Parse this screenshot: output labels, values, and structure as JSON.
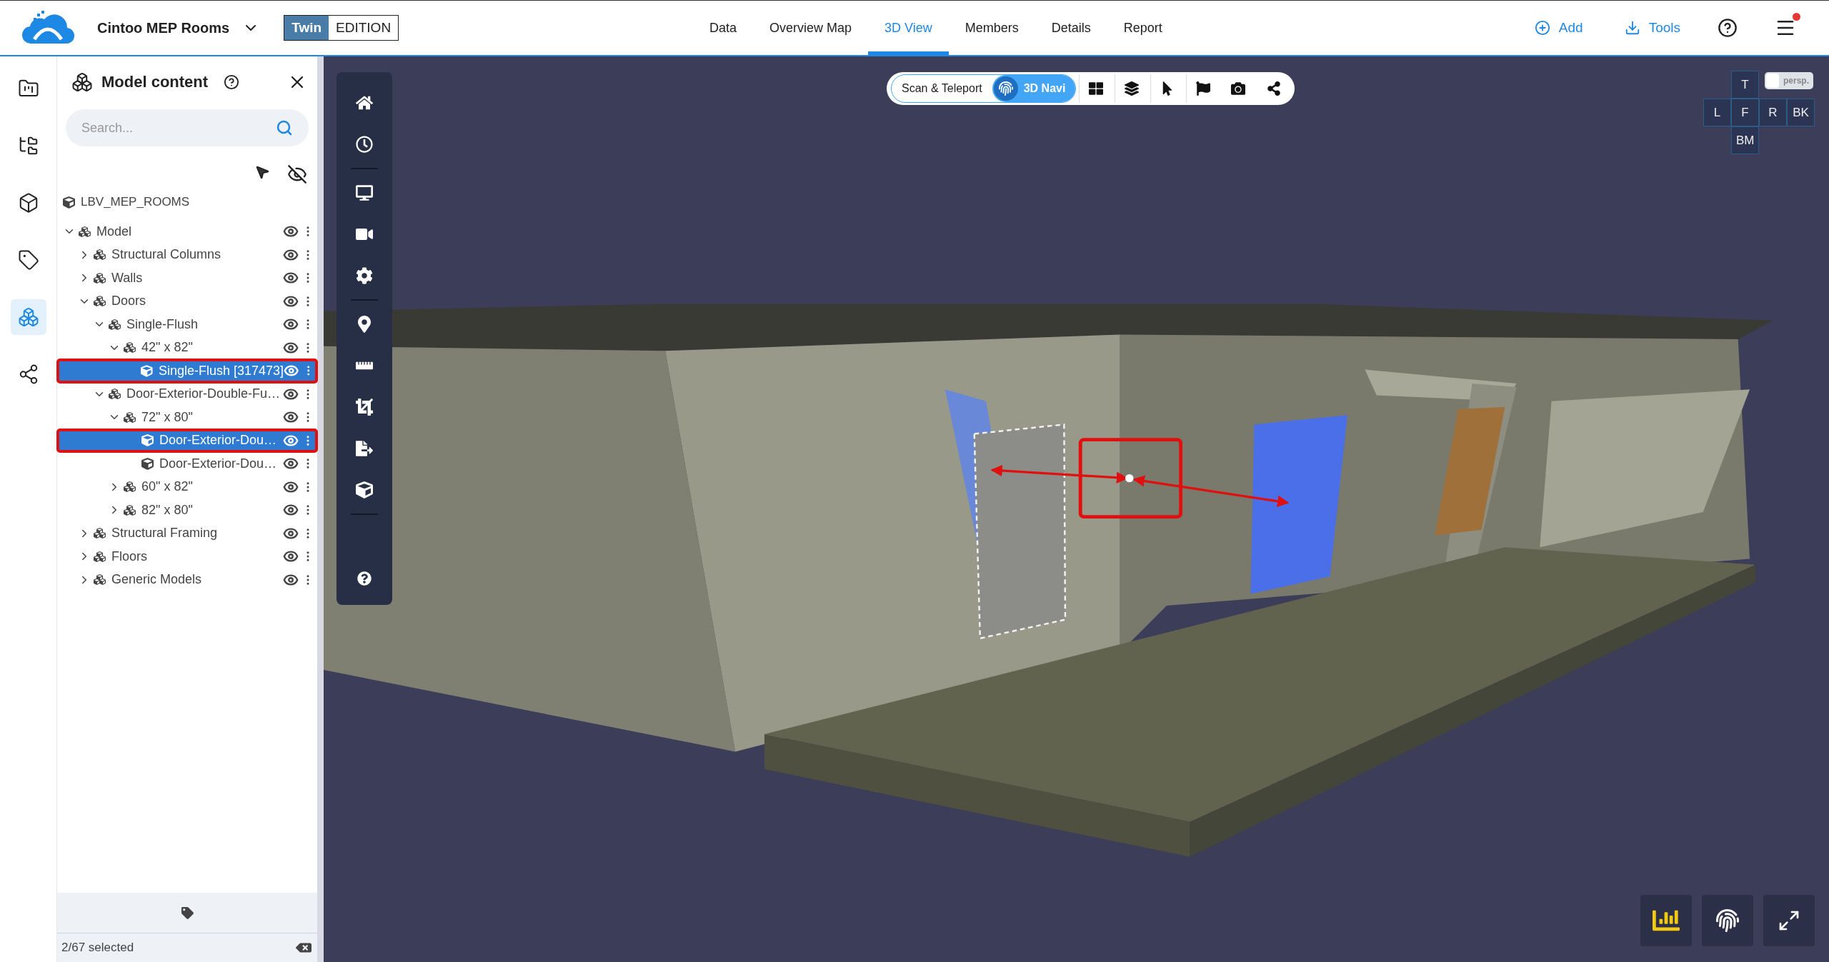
{
  "header": {
    "project": "Cintoo MEP Rooms",
    "edition_badge": {
      "highlight": "Twin",
      "rest": "EDITION"
    }
  },
  "tabs": [
    {
      "label": "Data",
      "selected": false
    },
    {
      "label": "Overview Map",
      "selected": false
    },
    {
      "label": "3D View",
      "selected": true
    },
    {
      "label": "Members",
      "selected": false
    },
    {
      "label": "Details",
      "selected": false
    },
    {
      "label": "Report",
      "selected": false
    }
  ],
  "actions": [
    {
      "label": "Add",
      "kind": "add"
    },
    {
      "label": "Tools",
      "kind": "download"
    }
  ],
  "rail": [
    {
      "selected": false
    },
    {
      "selected": false
    },
    {
      "selected": false
    },
    {
      "selected": false
    },
    {
      "selected": true
    },
    {
      "selected": false
    }
  ],
  "panel": {
    "title": "Model content",
    "search": {
      "placeholder": "Search..."
    },
    "root": "LBV_MEP_ROOMS",
    "tree": [
      {
        "label": "Model",
        "kind": "group",
        "expanded": true,
        "selected": false,
        "children": [
          {
            "label": "Structural Columns",
            "kind": "group",
            "expanded": false,
            "selected": false
          },
          {
            "label": "Walls",
            "kind": "group",
            "expanded": false,
            "selected": false
          },
          {
            "label": "Doors",
            "kind": "group",
            "expanded": true,
            "selected": false,
            "children": [
              {
                "label": "Single-Flush",
                "kind": "group",
                "expanded": true,
                "selected": false,
                "children": [
                  {
                    "label": "42\" x 82\"",
                    "kind": "group",
                    "expanded": true,
                    "selected": false,
                    "children": [
                      {
                        "label": "Single-Flush [317473]",
                        "kind": "element",
                        "selected": true
                      }
                    ]
                  }
                ]
              },
              {
                "label": "Door-Exterior-Double-Fu…",
                "kind": "group",
                "expanded": true,
                "selected": false,
                "children": [
                  {
                    "label": "72\" x 80\"",
                    "kind": "group",
                    "expanded": true,
                    "selected": false,
                    "children": [
                      {
                        "label": "Door-Exterior-Dou…",
                        "kind": "element",
                        "selected": true
                      },
                      {
                        "label": "Door-Exterior-Dou…",
                        "kind": "element",
                        "selected": false
                      }
                    ]
                  },
                  {
                    "label": "60\" x 82\"",
                    "kind": "group",
                    "expanded": false,
                    "selected": false
                  },
                  {
                    "label": "82\" x 80\"",
                    "kind": "group",
                    "expanded": false,
                    "selected": false
                  }
                ]
              }
            ]
          },
          {
            "label": "Structural Framing",
            "kind": "group",
            "expanded": false,
            "selected": false
          },
          {
            "label": "Floors",
            "kind": "group",
            "expanded": false,
            "selected": false
          },
          {
            "label": "Generic Models",
            "kind": "group",
            "expanded": false,
            "selected": false
          }
        ]
      }
    ],
    "status": "2/67 selected"
  },
  "view_toolbar": {
    "modes": [
      {
        "label": "Scan & Teleport",
        "selected": false
      },
      {
        "label": "3D Navi",
        "selected": true
      }
    ]
  },
  "view_cube": {
    "faces": [
      "T",
      "L",
      "F",
      "R",
      "BK",
      "BM"
    ],
    "projection": {
      "label": "persp.",
      "on": false
    }
  }
}
